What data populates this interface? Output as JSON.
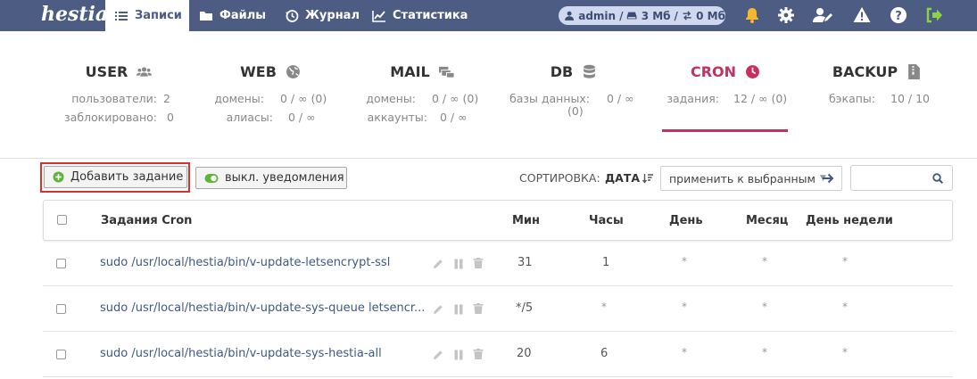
{
  "app": {
    "logo": "hestia"
  },
  "nav": {
    "records": "Записи",
    "files": "Файлы",
    "journal": "Журнал",
    "stats": "Статистика"
  },
  "status": {
    "user": "admin",
    "disk": "3 Мб",
    "traffic": "0 Мб"
  },
  "stats": {
    "user": {
      "title": "USER",
      "rows": [
        {
          "label": "пользователи:",
          "value": "2"
        },
        {
          "label": "заблокировано:",
          "value": "0"
        }
      ]
    },
    "web": {
      "title": "WEB",
      "rows": [
        {
          "label": "домены:",
          "value": "0 / ∞ (0)"
        },
        {
          "label": "алиасы:",
          "value": "0 / ∞"
        }
      ]
    },
    "mail": {
      "title": "MAIL",
      "rows": [
        {
          "label": "домены:",
          "value": "0 / ∞ (0)"
        },
        {
          "label": "аккаунты:",
          "value": "0 / ∞"
        }
      ]
    },
    "db": {
      "title": "DB",
      "rows": [
        {
          "label": "базы данных:",
          "value": "0 / ∞"
        },
        {
          "label": "(0)",
          "value": ""
        }
      ]
    },
    "cron": {
      "title": "CRON",
      "rows": [
        {
          "label": "задания:",
          "value": "12 / ∞ (0)"
        }
      ]
    },
    "backup": {
      "title": "BACKUP",
      "rows": [
        {
          "label": "бэкапы:",
          "value": "10 / 10"
        }
      ]
    }
  },
  "toolbar": {
    "add_label": "Добавить задание",
    "notify_label": "выкл. уведомления",
    "sort_label": "СОРТИРОВКА:",
    "sort_value": "ДАТА",
    "apply_label": "применить к выбранным"
  },
  "table": {
    "headers": {
      "name": "Задания Cron",
      "min": "Мин",
      "hour": "Часы",
      "day": "День",
      "month": "Месяц",
      "weekday": "День недели"
    },
    "rows": [
      {
        "cmd": "sudo /usr/local/hestia/bin/v-update-letsencrypt-ssl",
        "min": "31",
        "hour": "1",
        "day": "*",
        "month": "*",
        "weekday": "*"
      },
      {
        "cmd": "sudo /usr/local/hestia/bin/v-update-sys-queue letsencr...",
        "min": "*/5",
        "hour": "*",
        "day": "*",
        "month": "*",
        "weekday": "*"
      },
      {
        "cmd": "sudo /usr/local/hestia/bin/v-update-sys-hestia-all",
        "min": "20",
        "hour": "6",
        "day": "*",
        "month": "*",
        "weekday": "*"
      }
    ]
  },
  "colors": {
    "topbar": "#4d5c82",
    "accent": "#c5315e",
    "link": "#3f5887",
    "highlight": "#d9312b"
  }
}
